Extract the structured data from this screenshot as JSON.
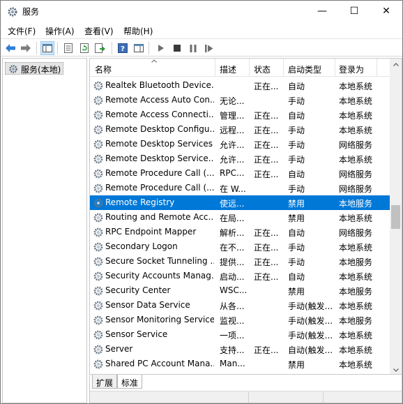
{
  "window": {
    "title": "服务"
  },
  "controls": {
    "minimize": "—",
    "maximize": "☐",
    "close": "✕"
  },
  "menu": [
    "文件(F)",
    "操作(A)",
    "查看(V)",
    "帮助(H)"
  ],
  "tree": {
    "root_label": "服务(本地)"
  },
  "columns": {
    "name": "名称",
    "description": "描述",
    "status": "状态",
    "startup": "启动类型",
    "logon": "登录为"
  },
  "services": [
    {
      "name": "Realtek Bluetooth Device...",
      "description": "",
      "status": "正在...",
      "startup": "自动",
      "logon": "本地系统"
    },
    {
      "name": "Remote Access Auto Con...",
      "description": "无论...",
      "status": "",
      "startup": "手动",
      "logon": "本地系统"
    },
    {
      "name": "Remote Access Connecti...",
      "description": "管理...",
      "status": "正在...",
      "startup": "自动",
      "logon": "本地系统"
    },
    {
      "name": "Remote Desktop Configu...",
      "description": "远程...",
      "status": "正在...",
      "startup": "手动",
      "logon": "本地系统"
    },
    {
      "name": "Remote Desktop Services",
      "description": "允许...",
      "status": "正在...",
      "startup": "手动",
      "logon": "网络服务"
    },
    {
      "name": "Remote Desktop Service...",
      "description": "允许...",
      "status": "正在...",
      "startup": "手动",
      "logon": "本地系统"
    },
    {
      "name": "Remote Procedure Call (...",
      "description": "RPC...",
      "status": "正在...",
      "startup": "自动",
      "logon": "网络服务"
    },
    {
      "name": "Remote Procedure Call (...",
      "description": "在 W...",
      "status": "",
      "startup": "手动",
      "logon": "网络服务"
    },
    {
      "name": "Remote Registry",
      "description": "使远...",
      "status": "",
      "startup": "禁用",
      "logon": "本地服务",
      "selected": true
    },
    {
      "name": "Routing and Remote Acc...",
      "description": "在局...",
      "status": "",
      "startup": "禁用",
      "logon": "本地系统"
    },
    {
      "name": "RPC Endpoint Mapper",
      "description": "解析...",
      "status": "正在...",
      "startup": "自动",
      "logon": "网络服务"
    },
    {
      "name": "Secondary Logon",
      "description": "在不...",
      "status": "正在...",
      "startup": "手动",
      "logon": "本地系统"
    },
    {
      "name": "Secure Socket Tunneling ...",
      "description": "提供...",
      "status": "正在...",
      "startup": "手动",
      "logon": "本地服务"
    },
    {
      "name": "Security Accounts Manag...",
      "description": "启动...",
      "status": "正在...",
      "startup": "自动",
      "logon": "本地系统"
    },
    {
      "name": "Security Center",
      "description": "WSC...",
      "status": "",
      "startup": "禁用",
      "logon": "本地服务"
    },
    {
      "name": "Sensor Data Service",
      "description": "从各...",
      "status": "",
      "startup": "手动(触发...",
      "logon": "本地系统"
    },
    {
      "name": "Sensor Monitoring Service",
      "description": "监视...",
      "status": "",
      "startup": "手动(触发...",
      "logon": "本地服务"
    },
    {
      "name": "Sensor Service",
      "description": "一项...",
      "status": "",
      "startup": "手动(触发...",
      "logon": "本地系统"
    },
    {
      "name": "Server",
      "description": "支持...",
      "status": "正在...",
      "startup": "自动(触发...",
      "logon": "本地系统"
    },
    {
      "name": "Shared PC Account Mana...",
      "description": "Man...",
      "status": "",
      "startup": "禁用",
      "logon": "本地系统"
    }
  ],
  "tabs": [
    "扩展",
    "标准"
  ],
  "colors": {
    "selection": "#0078d7",
    "accent": "#1e7ad6"
  }
}
